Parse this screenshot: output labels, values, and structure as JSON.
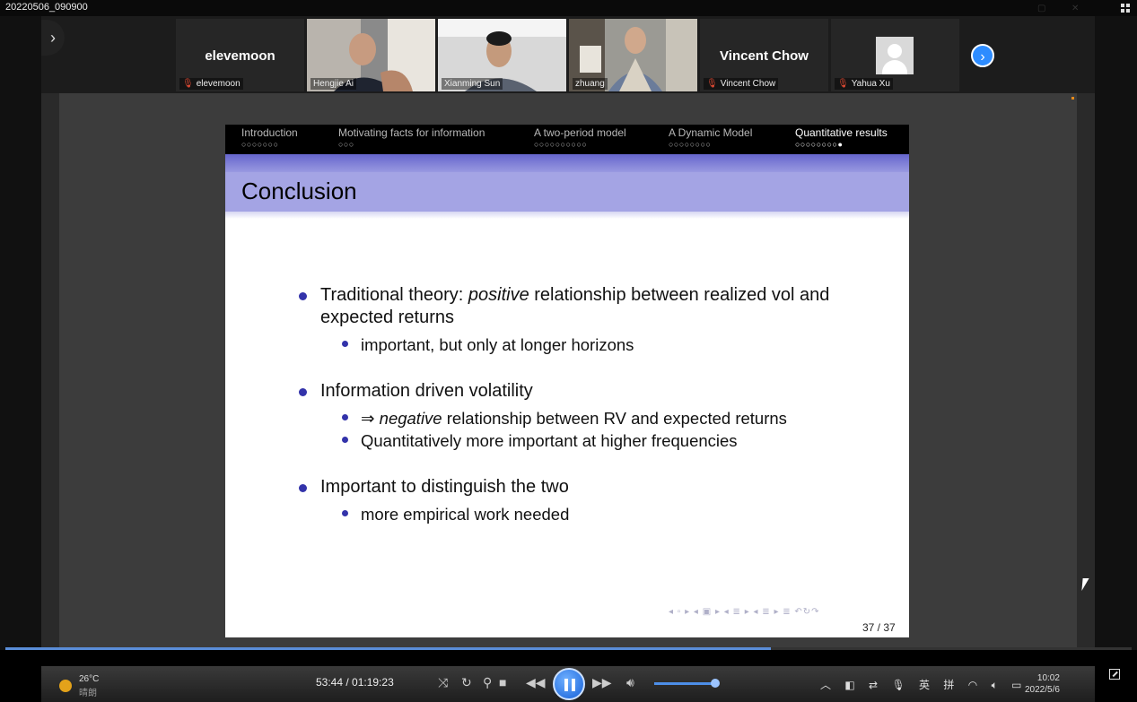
{
  "window": {
    "title": "20220506_090900"
  },
  "gallery": {
    "participants": [
      {
        "tile_name": "elevemoon",
        "label": "elevemoon",
        "muted": true,
        "video": false
      },
      {
        "label": "Hengjie Ai",
        "muted": false,
        "video": true
      },
      {
        "label": "Xianming Sun",
        "muted": false,
        "video": true
      },
      {
        "label": "zhuang",
        "muted": false,
        "video": true,
        "active_speaker": true
      },
      {
        "tile_name": "Vincent Chow",
        "label": "Vincent Chow",
        "muted": true,
        "video": false
      },
      {
        "label": "Yahua Xu",
        "muted": true,
        "video": false,
        "avatar": true
      }
    ],
    "prev_icon": "chevron-right-icon",
    "next_icon": "next-page-icon",
    "accent": "#2d8cff"
  },
  "slide": {
    "sections": [
      {
        "title": "Introduction",
        "dots": "○○○○○○○"
      },
      {
        "title": "Motivating facts for information",
        "dots": "○○○"
      },
      {
        "title": "A two-period model",
        "dots": "○○○○○○○○○○"
      },
      {
        "title": "A Dynamic Model",
        "dots": "○○○○○○○○"
      },
      {
        "title": "Quantitative results",
        "dots": "○○○○○○○○●",
        "current": true
      }
    ],
    "frame_title": "Conclusion",
    "bullets": [
      {
        "parts": [
          "Traditional theory: ",
          "positive",
          " relationship between realized vol and expected returns"
        ],
        "sub": [
          [
            "important, but only at longer horizons"
          ]
        ]
      },
      {
        "parts": [
          "Information driven volatility"
        ],
        "sub": [
          [
            "⇒ ",
            "negative",
            " relationship between RV and expected returns"
          ],
          [
            "Quantitatively more important at higher frequencies"
          ]
        ]
      },
      {
        "parts": [
          "Important to distinguish the two"
        ],
        "sub": [
          [
            "more empirical work needed"
          ]
        ]
      }
    ],
    "beamer_nav": "◂ ▫ ▸  ◂ ▣ ▸  ◂ ≣ ▸  ◂ ≣ ▸   ≣   ↶↻↷",
    "page_number": "37 / 37",
    "header_color": "#a4a4e4",
    "bullet_color": "#3333aa"
  },
  "player": {
    "progress": 0.68,
    "time": "53:44 / 01:19:23",
    "play_state": "paused-icon",
    "volume": 0.95
  },
  "taskbar": {
    "temperature": "26°C",
    "condition": "晴朗",
    "ime_lang": "英",
    "ime_mode": "拼",
    "time": "10:02",
    "date": "2022/5/6"
  }
}
